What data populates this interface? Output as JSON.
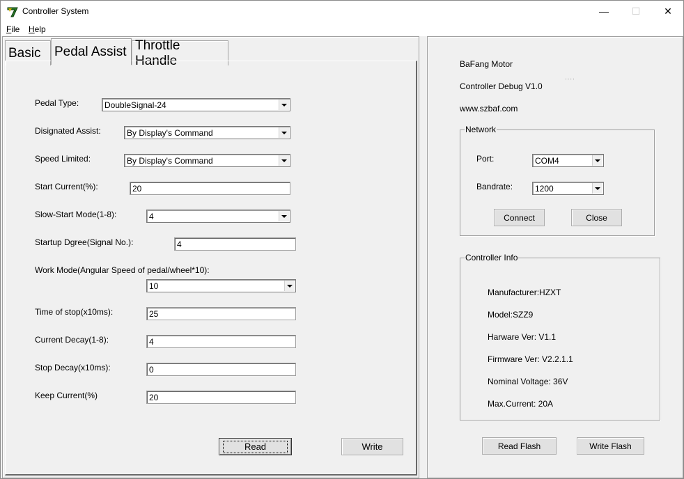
{
  "window": {
    "title": "Controller System",
    "minimize_glyph": "—",
    "maximize_glyph": "☐",
    "close_glyph": "✕"
  },
  "menu": {
    "file": {
      "accel": "F",
      "rest": "ile"
    },
    "help": {
      "accel": "H",
      "rest": "elp"
    }
  },
  "tabs": [
    {
      "label": "Basic"
    },
    {
      "label": "Pedal Assist"
    },
    {
      "label": "Throttle Handle"
    }
  ],
  "pedal": {
    "pedal_type": {
      "label": "Pedal Type:",
      "value": "DoubleSignal-24"
    },
    "designated_assist": {
      "label": "Disignated Assist:",
      "value": "By Display's Command"
    },
    "speed_limited": {
      "label": "Speed Limited:",
      "value": "By Display's Command"
    },
    "start_current": {
      "label": "Start Current(%):",
      "value": "20"
    },
    "slow_start": {
      "label": "Slow-Start Mode(1-8):",
      "value": "4"
    },
    "startup_degree": {
      "label": "Startup Dgree(Signal No.):",
      "value": "4"
    },
    "work_mode": {
      "label": "Work Mode(Angular Speed of pedal/wheel*10):",
      "value": "10"
    },
    "time_of_stop": {
      "label": "Time of stop(x10ms):",
      "value": "25"
    },
    "current_decay": {
      "label": "Current Decay(1-8):",
      "value": "4"
    },
    "stop_decay": {
      "label": "Stop Decay(x10ms):",
      "value": "0"
    },
    "keep_current": {
      "label": "Keep Current(%)",
      "value": "20"
    },
    "read_label": "Read",
    "write_label": "Write"
  },
  "info": {
    "brand": "BaFang Motor",
    "version": "Controller Debug V1.0",
    "website": "www.szbaf.com"
  },
  "network": {
    "title": "Network",
    "port_label": "Port:",
    "port_value": "COM4",
    "baud_label": "Bandrate:",
    "baud_value": "1200",
    "connect_label": "Connect",
    "close_label": "Close"
  },
  "controller_info": {
    "title": "Controller Info",
    "manufacturer": "Manufacturer:HZXT",
    "model": "Model:SZZ9",
    "hardware": "Harware Ver: V1.1",
    "firmware": "Firmware Ver: V2.2.1.1",
    "voltage": "Nominal Voltage: 36V",
    "current": "Max.Current: 20A"
  },
  "flash": {
    "read_label": "Read Flash",
    "write_label": "Write Flash"
  }
}
